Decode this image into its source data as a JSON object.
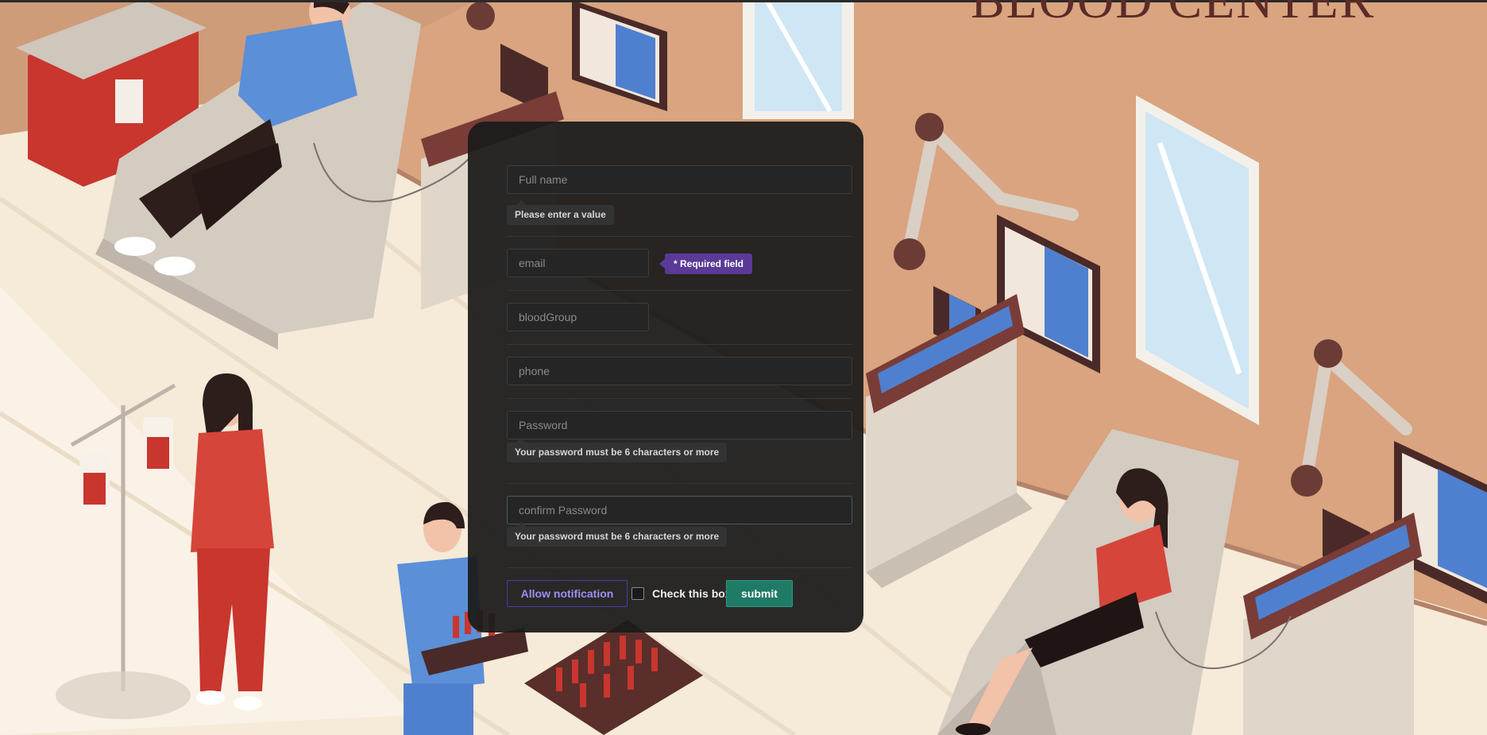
{
  "brand": {
    "title": "BLOOD CENTER"
  },
  "form": {
    "fullname": {
      "placeholder": "Full name",
      "hint": "Please enter a value"
    },
    "email": {
      "placeholder": "email",
      "badge": "* Required field"
    },
    "bloodgroup": {
      "placeholder": "bloodGroup"
    },
    "phone": {
      "placeholder": "phone"
    },
    "password": {
      "placeholder": "Password",
      "hint": "Your password must be 6 characters or more"
    },
    "confirm_password": {
      "placeholder": "confirm Password",
      "hint": "Your password must be 6 characters or more"
    },
    "allow_notification_label": "Allow notification",
    "checkbox_label": "Check this box",
    "submit_label": "submit"
  },
  "colors": {
    "wall": "#d9a47f",
    "accent_purple": "#5a3a96",
    "submit_green": "#1f7a66",
    "scrub_red": "#d6453a",
    "scrub_blue": "#5b8fd8"
  }
}
